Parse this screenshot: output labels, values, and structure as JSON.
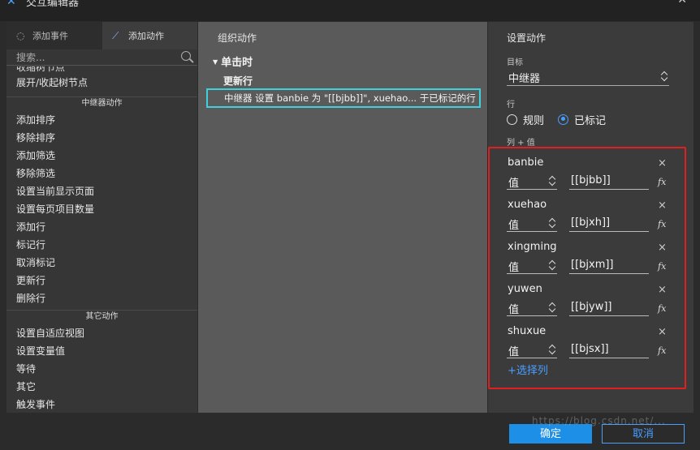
{
  "window": {
    "title": "交互编辑器"
  },
  "tabs": {
    "events": "添加事件",
    "actions": "添加动作"
  },
  "search": {
    "placeholder": "搜索..."
  },
  "action_list": {
    "cut_item": "收缩树节点",
    "item_expand": "展开/收起树节点",
    "group_repeater": "中继器动作",
    "repeater_items": [
      "添加排序",
      "移除排序",
      "添加筛选",
      "移除筛选",
      "设置当前显示页面",
      "设置每页项目数量",
      "添加行",
      "标记行",
      "取消标记",
      "更新行",
      "删除行"
    ],
    "group_other": "其它动作",
    "other_items": [
      "设置自适应视图",
      "设置变量值",
      "等待",
      "其它",
      "触发事件"
    ]
  },
  "organize": {
    "heading": "组织动作",
    "event": "单击时",
    "case": "更新行",
    "action": "中继器 设置 banbie 为 \"[[bjbb]]\", xuehao... 于已标记的行"
  },
  "settings": {
    "heading": "设置动作",
    "target_label": "目标",
    "target_value": "中继器",
    "row_label": "行",
    "row_options": [
      {
        "label": "规则",
        "checked": false
      },
      {
        "label": "已标记",
        "checked": true
      }
    ],
    "columns_label": "列 + 值",
    "columns": [
      {
        "name": "banbie",
        "type": "值",
        "value": "[[bjbb]]"
      },
      {
        "name": "xuehao",
        "type": "值",
        "value": "[[bjxh]]"
      },
      {
        "name": "xingming",
        "type": "值",
        "value": "[[bjxm]]"
      },
      {
        "name": "yuwen",
        "type": "值",
        "value": "[[bjyw]]"
      },
      {
        "name": "shuxue",
        "type": "值",
        "value": "[[bjsx]]"
      }
    ],
    "select_column": "+选择列",
    "remove_glyph": "×",
    "fx_glyph": "fx"
  },
  "footer": {
    "ok": "确定",
    "cancel": "取消",
    "watermark": "https://blog.csdn.net/..."
  },
  "colors": {
    "accent": "#1e8fe6",
    "highlight": "#3fd0dc",
    "annotation": "#e02020"
  }
}
